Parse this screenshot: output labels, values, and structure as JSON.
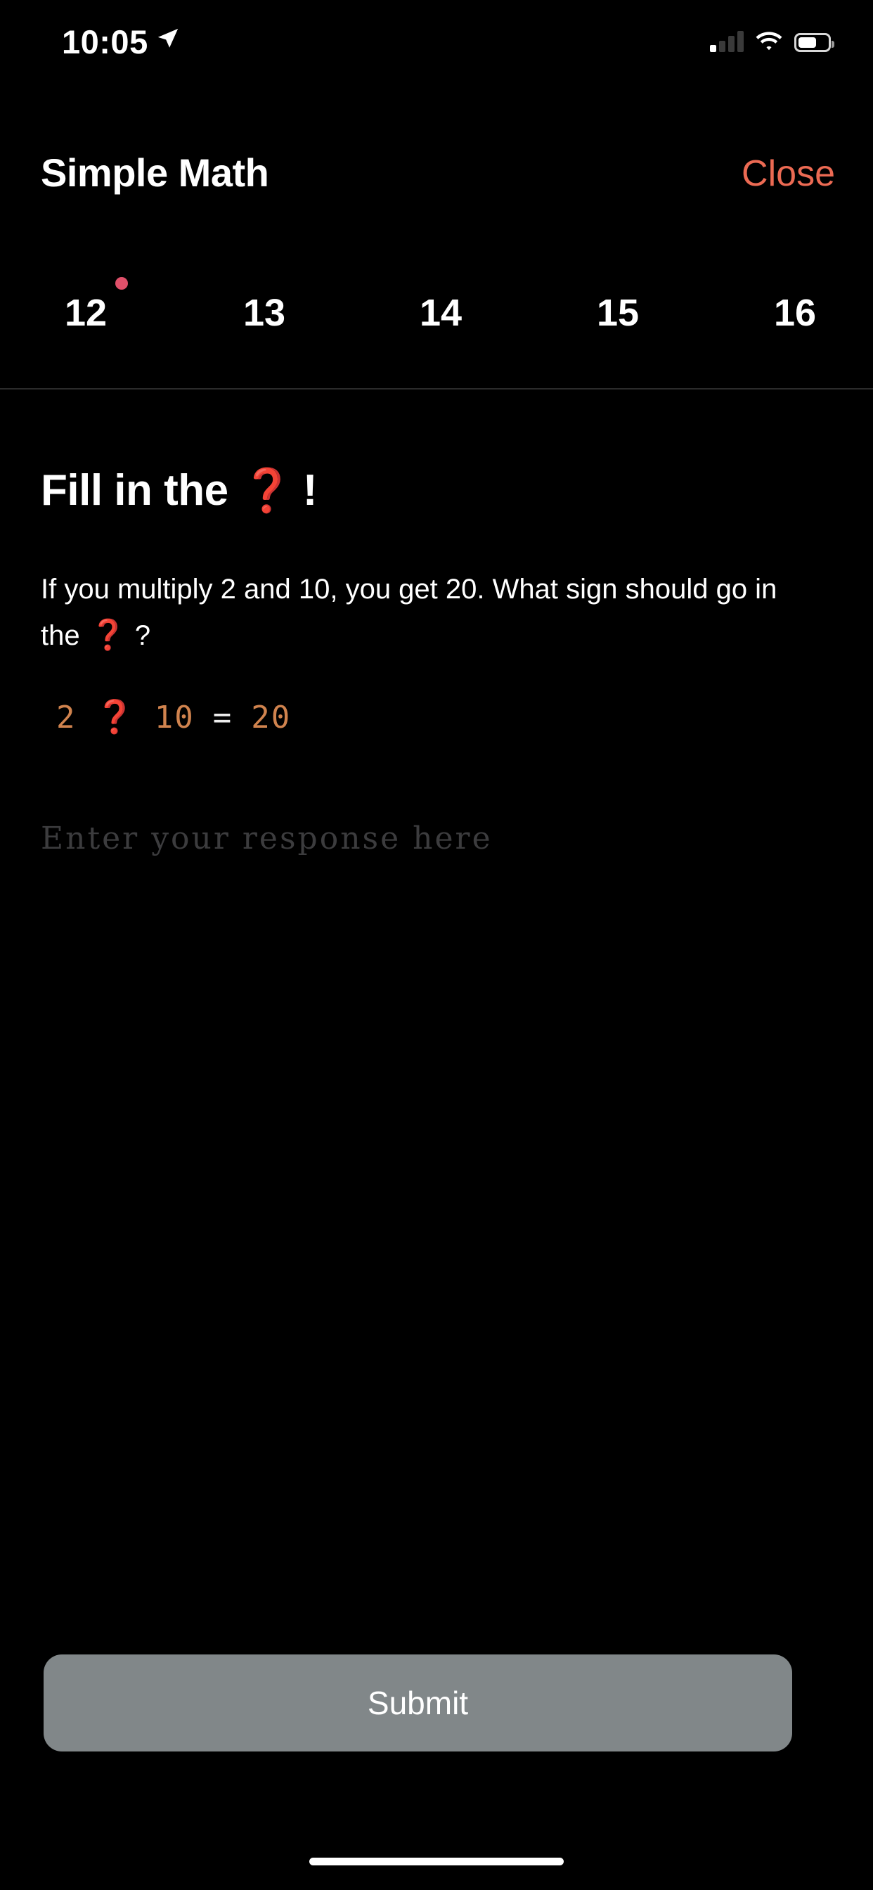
{
  "status_bar": {
    "time": "10:05",
    "location_icon": "location-arrow-icon",
    "cellular_icon": "cellular-signal-icon",
    "cellular_bars_active": 1,
    "cellular_bars_total": 4,
    "wifi_icon": "wifi-icon",
    "battery_icon": "battery-icon",
    "battery_level_percent": 55
  },
  "header": {
    "title": "Simple Math",
    "close_label": "Close",
    "close_color": "#EC6A53"
  },
  "pager": {
    "items": [
      {
        "label": "12",
        "active": true
      },
      {
        "label": "13",
        "active": false
      },
      {
        "label": "14",
        "active": false
      },
      {
        "label": "15",
        "active": false
      },
      {
        "label": "16",
        "active": false
      }
    ],
    "indicator_color": "#E0506A"
  },
  "main": {
    "headline_before": "Fill in the",
    "headline_qmark": "❓",
    "headline_after": "!",
    "prompt_text_line1": "If you multiply 2 and 10, you get 20. What sign should",
    "prompt_text_line2_before": "go in the",
    "prompt_qmark": "❓",
    "prompt_text_line2_after": "?",
    "equation": {
      "left_operand": "2",
      "operator_placeholder": "❓",
      "right_operand": "10",
      "equals": "=",
      "result": "20",
      "number_color": "#D0834E",
      "qmark_color": "#D8230F"
    },
    "answer": {
      "value": "",
      "placeholder": "Enter your response here"
    }
  },
  "footer": {
    "submit_label": "Submit",
    "submit_color": "#818789"
  }
}
